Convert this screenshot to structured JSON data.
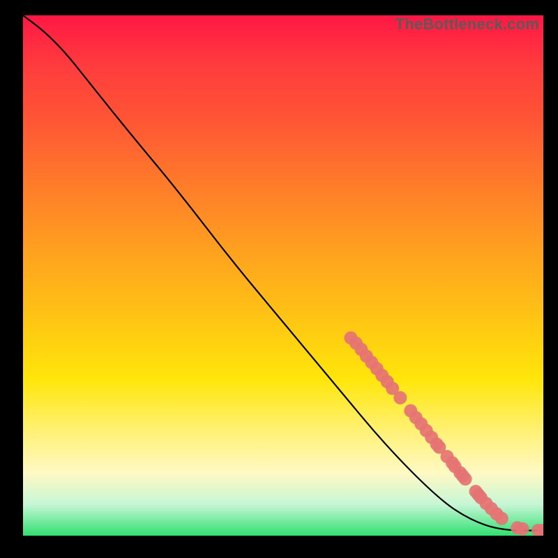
{
  "watermark": "TheBottleneck.com",
  "chart_data": {
    "type": "line",
    "title": "",
    "xlabel": "",
    "ylabel": "",
    "xlim": [
      0,
      100
    ],
    "ylim": [
      0,
      100
    ],
    "curve": [
      {
        "x": 0,
        "y": 100
      },
      {
        "x": 4,
        "y": 97
      },
      {
        "x": 8,
        "y": 93
      },
      {
        "x": 12,
        "y": 88
      },
      {
        "x": 20,
        "y": 78
      },
      {
        "x": 30,
        "y": 66
      },
      {
        "x": 40,
        "y": 53
      },
      {
        "x": 50,
        "y": 41
      },
      {
        "x": 60,
        "y": 29
      },
      {
        "x": 70,
        "y": 17
      },
      {
        "x": 80,
        "y": 7
      },
      {
        "x": 86,
        "y": 3
      },
      {
        "x": 92,
        "y": 1
      },
      {
        "x": 100,
        "y": 1
      }
    ],
    "series": [
      {
        "name": "cluster",
        "color": "#e57373",
        "points": [
          {
            "x": 63,
            "y": 38
          },
          {
            "x": 64,
            "y": 37
          },
          {
            "x": 65,
            "y": 35.8
          },
          {
            "x": 66,
            "y": 34.5
          },
          {
            "x": 67,
            "y": 33.3
          },
          {
            "x": 68,
            "y": 32.1
          },
          {
            "x": 69,
            "y": 30.8
          },
          {
            "x": 70,
            "y": 29.6
          },
          {
            "x": 71,
            "y": 28.3
          },
          {
            "x": 72.5,
            "y": 26.5
          },
          {
            "x": 74.5,
            "y": 24
          },
          {
            "x": 75.5,
            "y": 22.7
          },
          {
            "x": 76.5,
            "y": 21.5
          },
          {
            "x": 77.5,
            "y": 20.2
          },
          {
            "x": 78.5,
            "y": 18.9
          },
          {
            "x": 79.5,
            "y": 17.6
          },
          {
            "x": 80,
            "y": 17
          },
          {
            "x": 81.5,
            "y": 15.2
          },
          {
            "x": 82.5,
            "y": 14
          },
          {
            "x": 83,
            "y": 13.3
          },
          {
            "x": 84,
            "y": 12.1
          },
          {
            "x": 84.5,
            "y": 11.5
          },
          {
            "x": 85,
            "y": 10.9
          },
          {
            "x": 87,
            "y": 8.5
          },
          {
            "x": 87.5,
            "y": 7.9
          },
          {
            "x": 88,
            "y": 7.3
          },
          {
            "x": 89,
            "y": 6.2
          },
          {
            "x": 90,
            "y": 5.2
          },
          {
            "x": 91,
            "y": 4.2
          },
          {
            "x": 92,
            "y": 3.3
          },
          {
            "x": 95,
            "y": 1.5
          },
          {
            "x": 96,
            "y": 1.3
          },
          {
            "x": 99,
            "y": 1.0
          },
          {
            "x": 100,
            "y": 1.0
          }
        ]
      }
    ]
  }
}
